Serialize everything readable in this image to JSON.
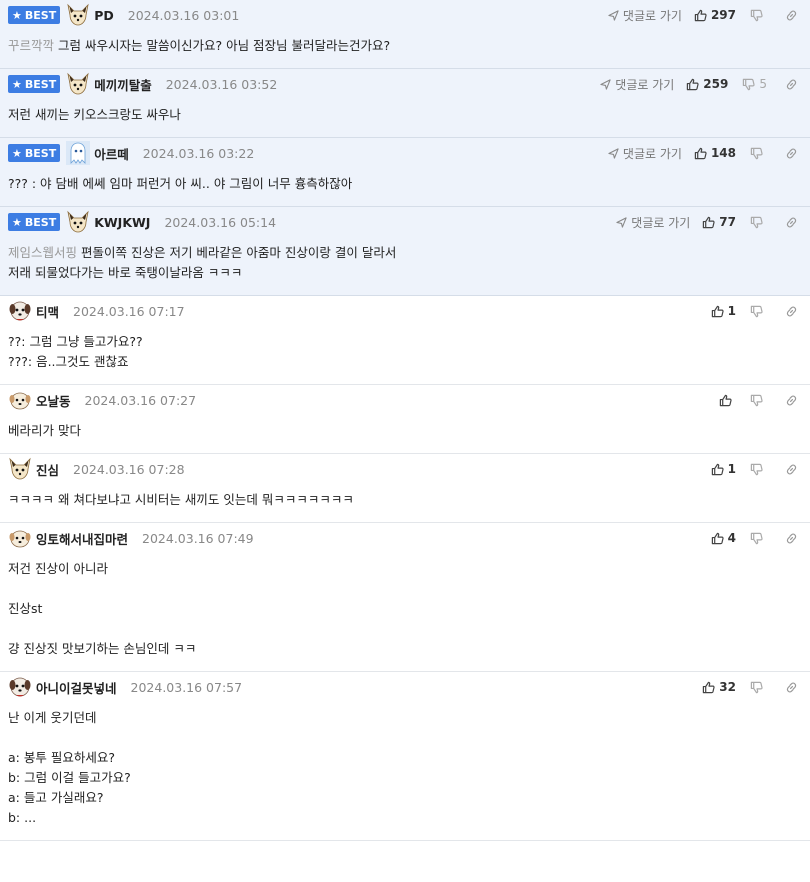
{
  "best_label": "BEST",
  "reply_label": "댓글로 가기",
  "comments": [
    {
      "best": true,
      "avatar": "fox-avatar",
      "nick": "PD",
      "date": "2024.03.16 03:01",
      "likes": "297",
      "dislikes": "",
      "tag": "꾸르깍깍",
      "lines": [
        "그럼 싸우시자는 말씀이신가요? 아님 점장님 불러달라는건가요?"
      ]
    },
    {
      "best": true,
      "avatar": "fox-avatar",
      "nick": "메끼끼탈출",
      "date": "2024.03.16 03:52",
      "likes": "259",
      "dislikes": "5",
      "tag": "",
      "lines": [
        "저런 새끼는 키오스크랑도 싸우나"
      ]
    },
    {
      "best": true,
      "avatar": "ghost-avatar",
      "nick": "아르떼",
      "date": "2024.03.16 03:22",
      "likes": "148",
      "dislikes": "",
      "tag": "",
      "lines": [
        "??? : 야 담배 에쎄 임마 퍼런거 아 씨.. 야 그림이 너무 흉측하잖아"
      ]
    },
    {
      "best": true,
      "avatar": "fox-avatar",
      "nick": "KWJKWJ",
      "date": "2024.03.16 05:14",
      "likes": "77",
      "dislikes": "",
      "tag": "제임스웹서핑",
      "lines": [
        "편돌이쪽 진상은 저기 베라같은 아줌마 진상이랑 결이 달라서",
        "저래 되물었다가는 바로 죽탱이날라옴 ㅋㅋㅋ"
      ]
    },
    {
      "best": false,
      "avatar": "dog-avatar",
      "nick": "티맥",
      "date": "2024.03.16 07:17",
      "likes": "1",
      "dislikes": "",
      "tag": "",
      "lines": [
        "??: 그럼 그냥 들고가요??",
        "???: 음..그것도 괜찮죠"
      ]
    },
    {
      "best": false,
      "avatar": "puppy-avatar",
      "nick": "오날동",
      "date": "2024.03.16 07:27",
      "likes": "",
      "dislikes": "",
      "tag": "",
      "lines": [
        "베라리가 맞다"
      ]
    },
    {
      "best": false,
      "avatar": "fox-avatar",
      "nick": "진심",
      "date": "2024.03.16 07:28",
      "likes": "1",
      "dislikes": "",
      "tag": "",
      "lines": [
        "ㅋㅋㅋㅋ 왜 쳐다보냐고 시비터는 새끼도 잇는데 뭐ㅋㅋㅋㅋㅋㅋㅋ"
      ]
    },
    {
      "best": false,
      "avatar": "puppy-avatar",
      "nick": "잉토해서내집마련",
      "date": "2024.03.16 07:49",
      "likes": "4",
      "dislikes": "",
      "tag": "",
      "lines": [
        "저건 진상이 아니라",
        "",
        "진상st",
        "",
        "걍 진상짓 맛보기하는 손님인데 ㅋㅋ"
      ]
    },
    {
      "best": false,
      "avatar": "dog-avatar",
      "nick": "아니이걸못넣네",
      "date": "2024.03.16 07:57",
      "likes": "32",
      "dislikes": "",
      "tag": "",
      "lines": [
        "난 이게 웃기던데",
        "",
        "a: 봉투 필요하세요?",
        "b: 그럼 이걸 들고가요?",
        "a: 들고 가실래요?",
        "b: ..."
      ]
    }
  ]
}
